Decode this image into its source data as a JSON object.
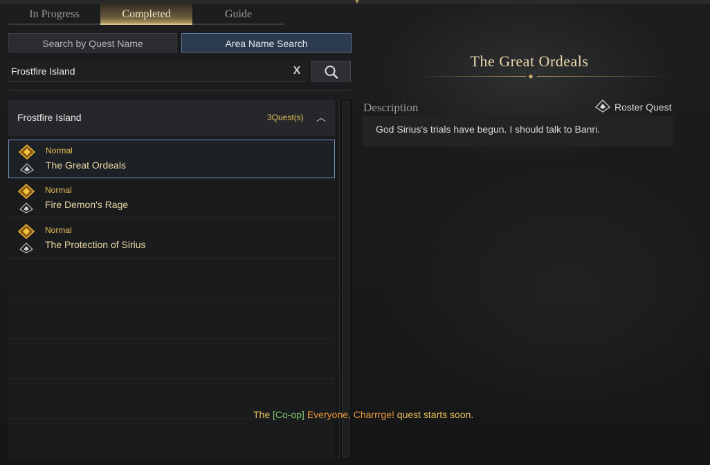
{
  "tabs": [
    {
      "label": "In Progress",
      "active": false
    },
    {
      "label": "Completed",
      "active": true
    },
    {
      "label": "Guide",
      "active": false
    }
  ],
  "search": {
    "mode_quest_label": "Search by Quest Name",
    "mode_area_label": "Area Name Search",
    "active_mode": "area",
    "value": "Frostfire Island",
    "clear_icon": "X"
  },
  "area": {
    "name": "Frostfire Island",
    "count": "3Quest(s)"
  },
  "quests": [
    {
      "type": "Normal",
      "name": "The Great Ordeals",
      "selected": true
    },
    {
      "type": "Normal",
      "name": "Fire Demon's Rage",
      "selected": false
    },
    {
      "type": "Normal",
      "name": "The Protection of Sirius",
      "selected": false
    }
  ],
  "detail": {
    "title": "The Great Ordeals",
    "description_label": "Description",
    "roster_label": "Roster Quest",
    "description": "God Sirius's trials have begun. I should talk to Banri."
  },
  "notice": {
    "prefix": "The",
    "tag": "[Co-op]",
    "quest": "Everyone, Charrrge!",
    "suffix": "quest starts soon."
  },
  "colors": {
    "accent_gold": "#e6c05a",
    "selected_border": "#6f93c2",
    "coop_green": "#7fc46a",
    "quest_orange": "#e9973a"
  }
}
